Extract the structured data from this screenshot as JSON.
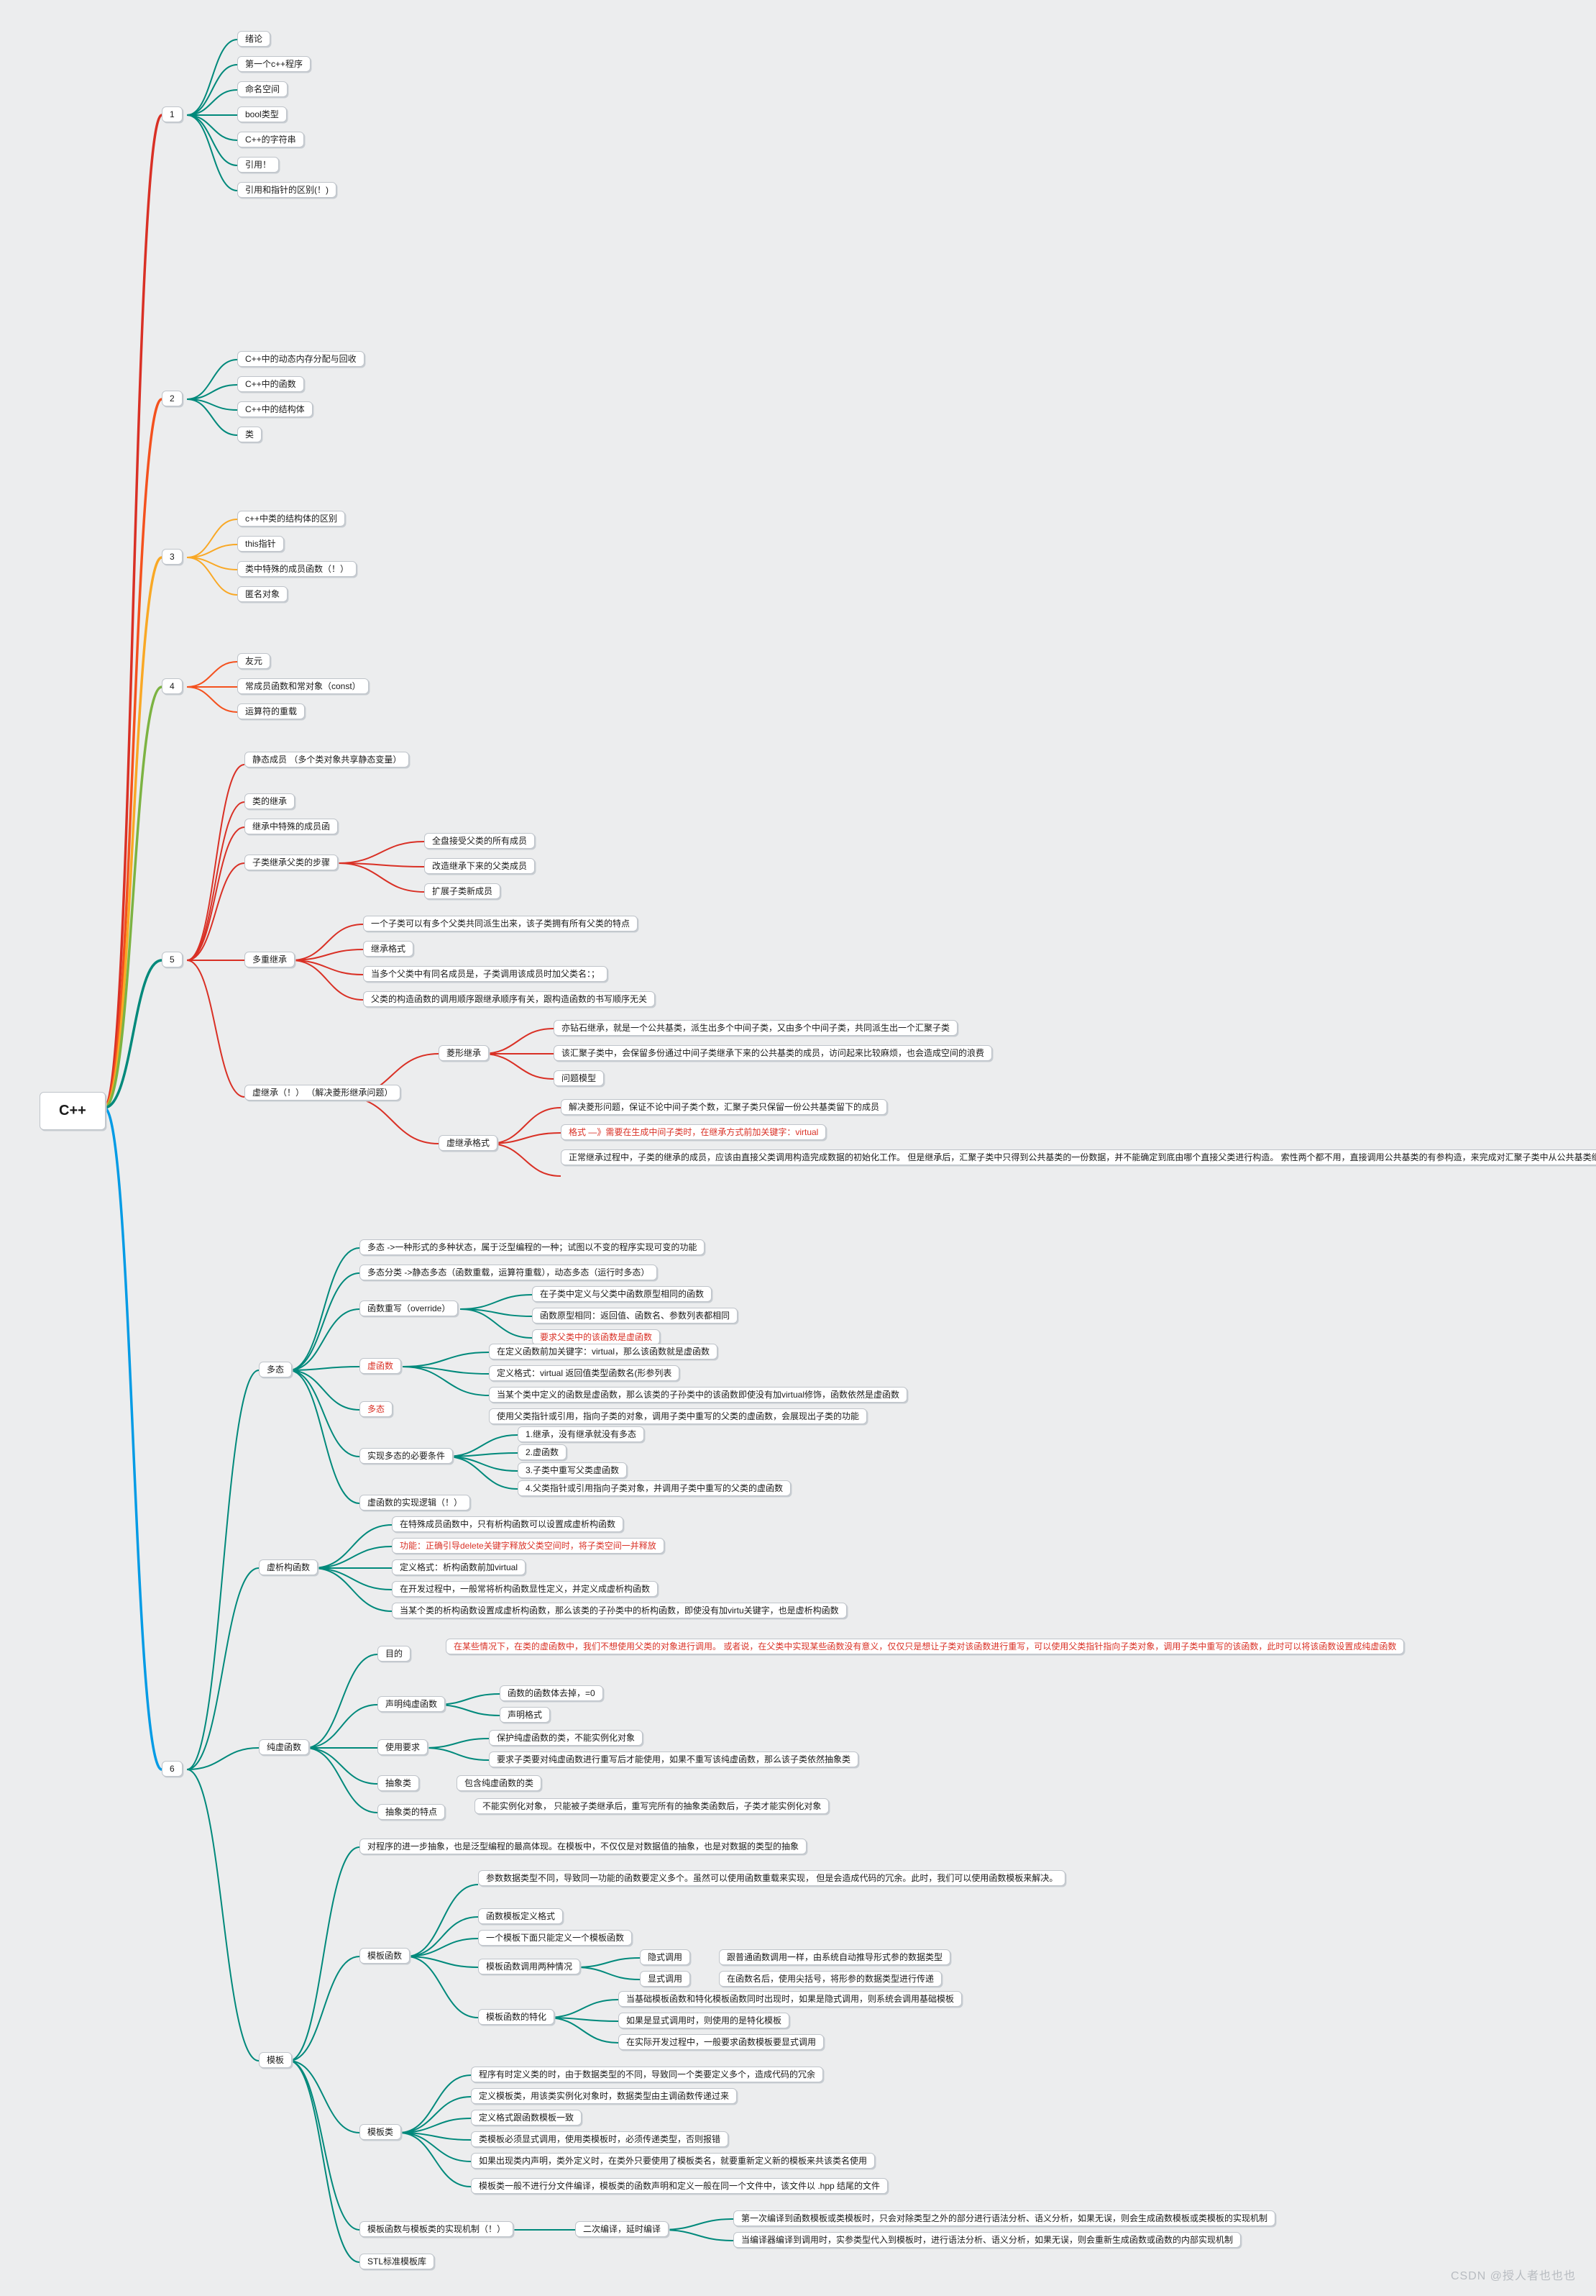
{
  "root": "C++",
  "watermark": "CSDN @授人者也也也",
  "sections": {
    "s1": {
      "num": "1",
      "items": [
        "绪论",
        "第一个c++程序",
        "命名空间",
        "bool类型",
        "C++的字符串",
        "引用！",
        "引用和指针的区别(！)"
      ]
    },
    "s2": {
      "num": "2",
      "items": [
        "C++中的动态内存分配与回收",
        "C++中的函数",
        "C++中的结构体",
        "类"
      ]
    },
    "s3": {
      "num": "3",
      "items": [
        "c++中类的结构体的区别",
        "this指针",
        "类中特殊的成员函数（！）",
        "匿名对象"
      ]
    },
    "s4": {
      "num": "4",
      "items": [
        "友元",
        "常成员函数和常对象（const）",
        "运算符的重载"
      ]
    }
  },
  "s5": {
    "num": "5",
    "items": [
      "静态成员\n（多个类对象共享静态变量）",
      "类的继承",
      "继承中特殊的成员函"
    ],
    "sub_inherit": {
      "label": "子类继承父类的步骤",
      "children": [
        "全盘接受父类的所有成员",
        "改造继承下来的父类成员",
        "扩展子类新成员"
      ]
    },
    "multi": {
      "label": "多重继承",
      "children": [
        "一个子类可以有多个父类共同派生出来，该子类拥有所有父类的特点",
        "继承格式",
        "当多个父类中有同名成员是，子类调用该成员时加父类名：；",
        "父类的构造函数的调用顺序跟继承顺序有关，跟构造函数的书写顺序无关"
      ]
    },
    "virtual": {
      "label": "虚继承（！）\n（解决菱形继承问题）",
      "diamond": {
        "label": "菱形继承",
        "children": [
          "亦钻石继承，就是一个公共基类，派生出多个中间子类，又由多个中间子类，共同派生出一个汇聚子类",
          "该汇聚子类中，会保留多份通过中间子类继承下来的公共基类的成员，访问起来比较麻烦，也会造成空间的浪费",
          "问题模型"
        ]
      },
      "vformat": {
        "label": "虚继承格式",
        "children": [
          "解决菱形问题，保证不论中间子类个数，汇聚子类只保留一份公共基类留下的成员",
          "格式 —》需要在生成中间子类时，在继承方式前加关键字：virtual",
          "正常继承过程中，子类的继承的成员，应该由直接父类调用构造完成数据的初始化工作。\n但是继承后，汇聚子类中只得到公共基类的一份数据，并不能确定到底由哪个直接父类进行构造。\n索性两个都不用，直接调用公共基类的有参构造，来完成对汇聚子类中从公共基类继承下来成员的初始化工作。\n如果没在汇聚子类的构造函数初始化列表中，显性调用公共基类的有参构造，则系统会自动调用公共基类的无参构造来完成相关初始化工作"
        ]
      }
    }
  },
  "s6": {
    "num": "6",
    "poly": {
      "label": "多态",
      "head": [
        "多态 ->一种形式的多种状态，属于泛型编程的一种；试图以不变的程序实现可变的功能",
        "多态分类 ->静态多态（函数重载，运算符重载），动态多态（运行时多态）"
      ],
      "override": {
        "label": "函数重写（override）",
        "children": [
          "在子类中定义与父类中函数原型相同的函数",
          "函数原型相同：返回值、函数名、参数列表都相同",
          "要求父类中的该函数是虚函数"
        ]
      },
      "vfunc": {
        "label": "虚函数",
        "children": [
          "在定义函数前加关键字：virtual，那么该函数就是虚函数",
          "定义格式：virtual 返回值类型函数名(形参列表",
          "当某个类中定义的函数是虚函数，那么该类的子孙类中的该函数即使没有加virtual修饰，函数依然是虚函数"
        ]
      },
      "duotai": {
        "label": "多态",
        "text": "使用父类指针或引用，指向子类的对象，调用子类中重写的父类的虚函数，会展现出子类的功能"
      },
      "cond": {
        "label": "实现多态的必要条件",
        "children": [
          "1.继承，没有继承就没有多态",
          "2.虚函数",
          "3.子类中重写父类虚函数",
          "4.父类指针或引用指向子类对象，并调用子类中重写的父类的虚函数"
        ]
      },
      "logic": "虚函数的实现逻辑（！）"
    },
    "vdtor": {
      "label": "虚析构函数",
      "children": [
        "在特殊成员函数中，只有析构函数可以设置成虚析构函数",
        "功能：正确引导delete关键字释放父类空间时，将子类空间一并释放",
        "定义格式：析构函数前加virtual",
        "在开发过程中，一般常将析构函数显性定义，并定义成虚析构函数",
        "当某个类的析构函数设置成虚析构函数，那么该类的子孙类中的析构函数，即使没有加virtu关键字，也是虚析构函数"
      ]
    },
    "pure": {
      "label": "纯虚函数",
      "purpose": {
        "label": "目的",
        "text": "在某些情况下，在类的虚函数中，我们不想使用父类的对象进行调用。\n或者说，在父类中实现某些函数没有意义，仅仅只是想让子类对该函数进行重写，可以使用父类指针指向子类对象，调用子类中重写的该函数，此时可以将该函数设置成纯虚函数"
      },
      "decl": {
        "label": "声明纯虚函数",
        "children": [
          "函数的函数体去掉，=0",
          "声明格式"
        ]
      },
      "req": {
        "label": "使用要求",
        "children": [
          "保护纯虚函数的类，不能实例化对象",
          "要求子类要对纯虚函数进行重写后才能使用，如果不重写该纯虚函数，那么该子类依然抽象类"
        ]
      },
      "abs": {
        "label": "抽象类",
        "text": "包含纯虚函数的类"
      },
      "absf": {
        "label": "抽象类的特点",
        "text": "不能实例化对象，\n只能被子类继承后，重写完所有的抽象类函数后，子类才能实例化对象"
      }
    },
    "tpl": {
      "label": "模板",
      "intro": "对程序的进一步抽象，也是泛型编程的最高体现。在模板中，不仅仅是对数据值的抽象，也是对数据的类型的抽象",
      "tfunc": {
        "label": "模板函数",
        "head": "参数数据类型不同，导致同一功能的函数要定义多个。虽然可以使用函数重载来实现，\n但是会造成代码的冗余。此时，我们可以使用函数模板来解决。",
        "children_a": [
          "函数模板定义格式",
          "一个模板下面只能定义一个模板函数"
        ],
        "call": {
          "label": "模板函数调用两种情况",
          "imp": {
            "label": "隐式调用",
            "text": "跟普通函数调用一样，由系统自动推导形式参的数据类型"
          },
          "exp": {
            "label": "显式调用",
            "text": "在函数名后，使用尖括号，将形参的数据类型进行传递"
          }
        },
        "spec": {
          "label": "模板函数的特化",
          "children": [
            "当基础模板函数和特化模板函数同时出现时，如果是隐式调用，则系统会调用基础模板",
            "如果是显式调用时，则使用的是特化模板",
            "在实际开发过程中，一般要求函数模板要显式调用"
          ]
        }
      },
      "tclass": {
        "label": "模板类",
        "children": [
          "程序有时定义类的时，由于数据类型的不同，导致同一个类要定义多个，造成代码的冗余",
          "定义模板类，用该类实例化对象时，数据类型由主调函数传递过来",
          "定义格式跟函数模板一致",
          "类模板必须显式调用，使用类模板时，必须传递类型，否则报错",
          "如果出现类内声明，类外定义时，在类外只要使用了模板类名，就要重新定义新的模板来共该类名使用",
          "模板类一般不进行分文件编译，模板类的函数声明和定义一般在同一个文件中，该文件以 .hpp 结尾的文件"
        ]
      },
      "mech": {
        "label": "模板函数与模板类的实现机制（！）",
        "mid": "二次编译，延时编译",
        "children": [
          "第一次编译到函数模板或类模板时，只会对除类型之外的部分进行语法分析、语义分析，如果无误，则会生成函数模板或类模板的实现机制",
          "当编译器编译到调用时，实参类型代入到模板时，进行语法分析、语义分析，如果无误，则会重新生成函数或函数的内部实现机制"
        ]
      },
      "stl": "STL标准模板库"
    }
  },
  "chart_data": {
    "type": "tree",
    "note": "C++ knowledge mind-map; root → 6 numbered groups → leaf topics (see sections/s5/s6 keys above for full hierarchy and leaf strings)"
  }
}
